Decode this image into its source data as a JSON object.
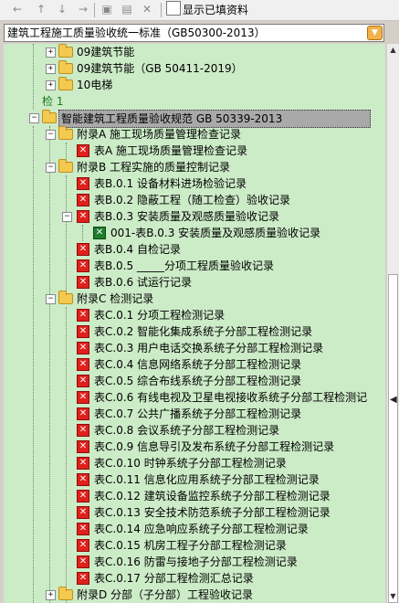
{
  "toolbar": {
    "icons": [
      "arrow-left-icon",
      "arrow-up-icon",
      "arrow-down-icon",
      "arrow-right-icon",
      "copy-icon",
      "paste-icon",
      "close-icon"
    ],
    "show_filled_label": "显示已填资料"
  },
  "standard_select": {
    "value": "建筑工程施工质量验收统一标准（GB50300-2013）"
  },
  "tree": {
    "nodes": [
      {
        "label": "09建筑节能"
      },
      {
        "label": "09建筑节能（GB 50411-2019）"
      },
      {
        "label": "10电梯"
      },
      {
        "label": "检 1"
      },
      {
        "label": "智能建筑工程质量验收规范 GB 50339-2013"
      },
      {
        "label": "附录A 施工现场质量管理检查记录"
      },
      {
        "label": "表A 施工现场质量管理检查记录"
      },
      {
        "label": "附录B 工程实施的质量控制记录"
      },
      {
        "label": "表B.0.1 设备材料进场检验记录"
      },
      {
        "label": "表B.0.2 隐蔽工程（随工检查）验收记录"
      },
      {
        "label": "表B.0.3 安装质量及观感质量验收记录"
      },
      {
        "label": "001-表B.0.3 安装质量及观感质量验收记录"
      },
      {
        "label": "表B.0.4 自检记录"
      },
      {
        "label": "表B.0.5 _____分项工程质量验收记录"
      },
      {
        "label": "表B.0.6 试运行记录"
      },
      {
        "label": "附录C 检测记录"
      },
      {
        "label": "表C.0.1 分项工程检测记录"
      },
      {
        "label": "表C.0.2 智能化集成系统子分部工程检测记录"
      },
      {
        "label": "表C.0.3 用户电话交换系统子分部工程检测记录"
      },
      {
        "label": "表C.0.4 信息网络系统子分部工程检测记录"
      },
      {
        "label": "表C.0.5 综合布线系统子分部工程检测记录"
      },
      {
        "label": "表C.0.6 有线电视及卫星电视接收系统子分部工程检测记"
      },
      {
        "label": "表C.0.7 公共广播系统子分部工程检测记录"
      },
      {
        "label": "表C.0.8 会议系统子分部工程检测记录"
      },
      {
        "label": "表C.0.9 信息导引及发布系统子分部工程检测记录"
      },
      {
        "label": "表C.0.10 时钟系统子分部工程检测记录"
      },
      {
        "label": "表C.0.11 信息化应用系统子分部工程检测记录"
      },
      {
        "label": "表C.0.12 建筑设备监控系统子分部工程检测记录"
      },
      {
        "label": "表C.0.13 安全技术防范系统子分部工程检测记录"
      },
      {
        "label": "表C.0.14 应急响应系统子分部工程检测记录"
      },
      {
        "label": "表C.0.15 机房工程子分部工程检测记录"
      },
      {
        "label": "表C.0.16 防雷与接地子分部工程检测记录"
      },
      {
        "label": "表C.0.17 分部工程检测汇总记录"
      },
      {
        "label": "附录D 分部（子分部）工程验收记录"
      }
    ]
  },
  "colors": {
    "tree_background": "#ccebc7",
    "form_icon_red": "#e0201b",
    "form_icon_green": "#1e7d2e",
    "folder": "#f3c94f",
    "selected": "#a9a9a9"
  }
}
